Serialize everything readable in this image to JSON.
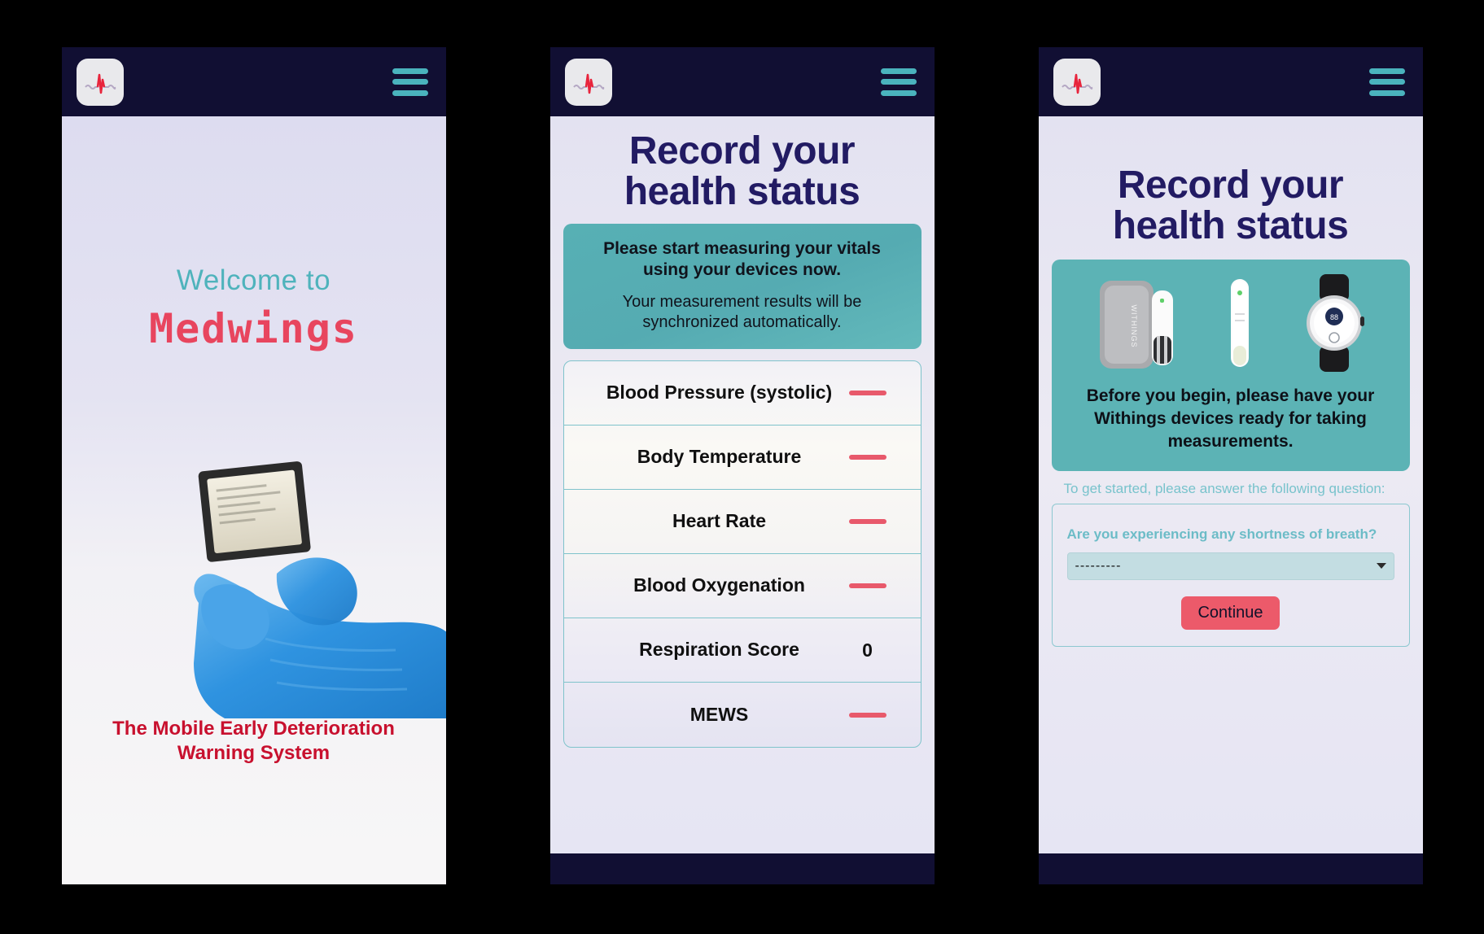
{
  "app": {
    "logo_icon": "ecg-heartbeat-icon",
    "menu_icon": "hamburger-menu-icon",
    "accent_teal": "#4fb3bc",
    "accent_red": "#e8455e",
    "navy": "#110f33"
  },
  "screen1": {
    "welcome_line": "Welcome to",
    "brand": "Medwings",
    "hero_image": "gloved-hand-holding-chip",
    "tagline": "The Mobile Early Deterioration Warning System"
  },
  "screen2": {
    "title_line1": "Record your",
    "title_line2": "health status",
    "banner_strong": "Please start measuring your vitals using your devices now.",
    "banner_sub": "Your measurement results will be synchronized automatically.",
    "vitals": [
      {
        "label": "Blood Pressure (systolic)",
        "value": "—",
        "has_value": false
      },
      {
        "label": "Body Temperature",
        "value": "—",
        "has_value": false
      },
      {
        "label": "Heart Rate",
        "value": "—",
        "has_value": false
      },
      {
        "label": "Blood Oxygenation",
        "value": "—",
        "has_value": false
      },
      {
        "label": "Respiration Score",
        "value": "0",
        "has_value": true
      },
      {
        "label": "MEWS",
        "value": "—",
        "has_value": false
      }
    ]
  },
  "screen3": {
    "title_line1": "Record your",
    "title_line2": "health status",
    "device_image": "withings-bp-cuff-thermometer-watch",
    "device_note": "Before you begin, please have your Withings devices ready for taking measurements.",
    "legend": "To get started, please answer the following question:",
    "question": "Are you experiencing any shortness of breath?",
    "select_value": "---------",
    "continue_label": "Continue"
  }
}
